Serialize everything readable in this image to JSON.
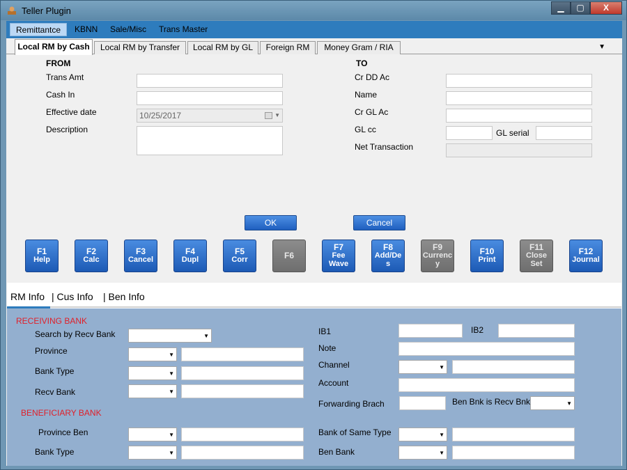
{
  "window": {
    "title": "Teller Plugin",
    "buttons": {
      "minimize": "▁",
      "maximize": "▢",
      "close": "X"
    }
  },
  "menu": [
    {
      "label": "Remittantce",
      "active": true
    },
    {
      "label": "KBNN"
    },
    {
      "label": "Sale/Misc"
    },
    {
      "label": "Trans Master"
    }
  ],
  "tabs": [
    {
      "label": "Local RM by Cash",
      "active": true
    },
    {
      "label": "Local RM by Transfer"
    },
    {
      "label": "Local RM by GL"
    },
    {
      "label": "Foreign RM"
    },
    {
      "label": "Money Gram / RIA"
    }
  ],
  "from": {
    "title": "FROM",
    "trans_amt_label": "Trans Amt",
    "trans_amt": "",
    "cash_in_label": "Cash In",
    "cash_in": "",
    "effective_date_label": "Effective date",
    "effective_date": "10/25/2017",
    "description_label": "Description",
    "description": ""
  },
  "to": {
    "title": "TO",
    "cr_dd_ac_label": "Cr DD Ac",
    "name_label": "Name",
    "cr_gl_ac_label": "Cr GL Ac",
    "gl_cc_label": "GL cc",
    "gl_serial_label": "GL serial",
    "net_transaction_label": "Net Transaction"
  },
  "actions": {
    "ok": "OK",
    "cancel": "Cancel"
  },
  "fkeys": [
    {
      "key": "F1",
      "label": "Help",
      "enabled": true
    },
    {
      "key": "F2",
      "label": "Calc",
      "enabled": true
    },
    {
      "key": "F3",
      "label": "Cancel",
      "enabled": true
    },
    {
      "key": "F4",
      "label": "Dupl",
      "enabled": true
    },
    {
      "key": "F5",
      "label": "Corr",
      "enabled": true
    },
    {
      "key": "F6",
      "label": "",
      "enabled": false
    },
    {
      "key": "F7",
      "label": "Fee\nWave",
      "enabled": true
    },
    {
      "key": "F8",
      "label": "Add/De\ns",
      "enabled": true
    },
    {
      "key": "F9",
      "label": "Currenc\ny",
      "enabled": false
    },
    {
      "key": "F10",
      "label": "Print",
      "enabled": true
    },
    {
      "key": "F11",
      "label": "Close\nSet",
      "enabled": false
    },
    {
      "key": "F12",
      "label": "Journal",
      "enabled": true
    }
  ],
  "info_tabs": {
    "rm": "RM Info",
    "cus": "|  Cus Info",
    "ben": "|  Ben Info"
  },
  "receiving": {
    "title": "RECEIVING BANK",
    "search_label": "Search by Recv Bank",
    "province_label": "Province",
    "bank_type_label": "Bank Type",
    "recv_bank_label": "Recv Bank"
  },
  "beneficiary": {
    "title": "BENEFICIARY BANK",
    "province_ben_label": "Province Ben",
    "bank_type_label": "Bank Type"
  },
  "right": {
    "ib1_label": "IB1",
    "ib2_label": "IB2",
    "note_label": "Note",
    "channel_label": "Channel",
    "account_label": "Account",
    "forwarding_label": "Forwarding Brach",
    "ben_is_recv_label": "Ben Bnk is Recv Bnk",
    "same_type_label": "Bank of Same Type",
    "ben_bank_label": "Ben Bank"
  },
  "colors": {
    "menubar": "#2e7cbd",
    "fkey": "#2a6fce",
    "panel": "#93afcf",
    "required": "#e0202a"
  }
}
